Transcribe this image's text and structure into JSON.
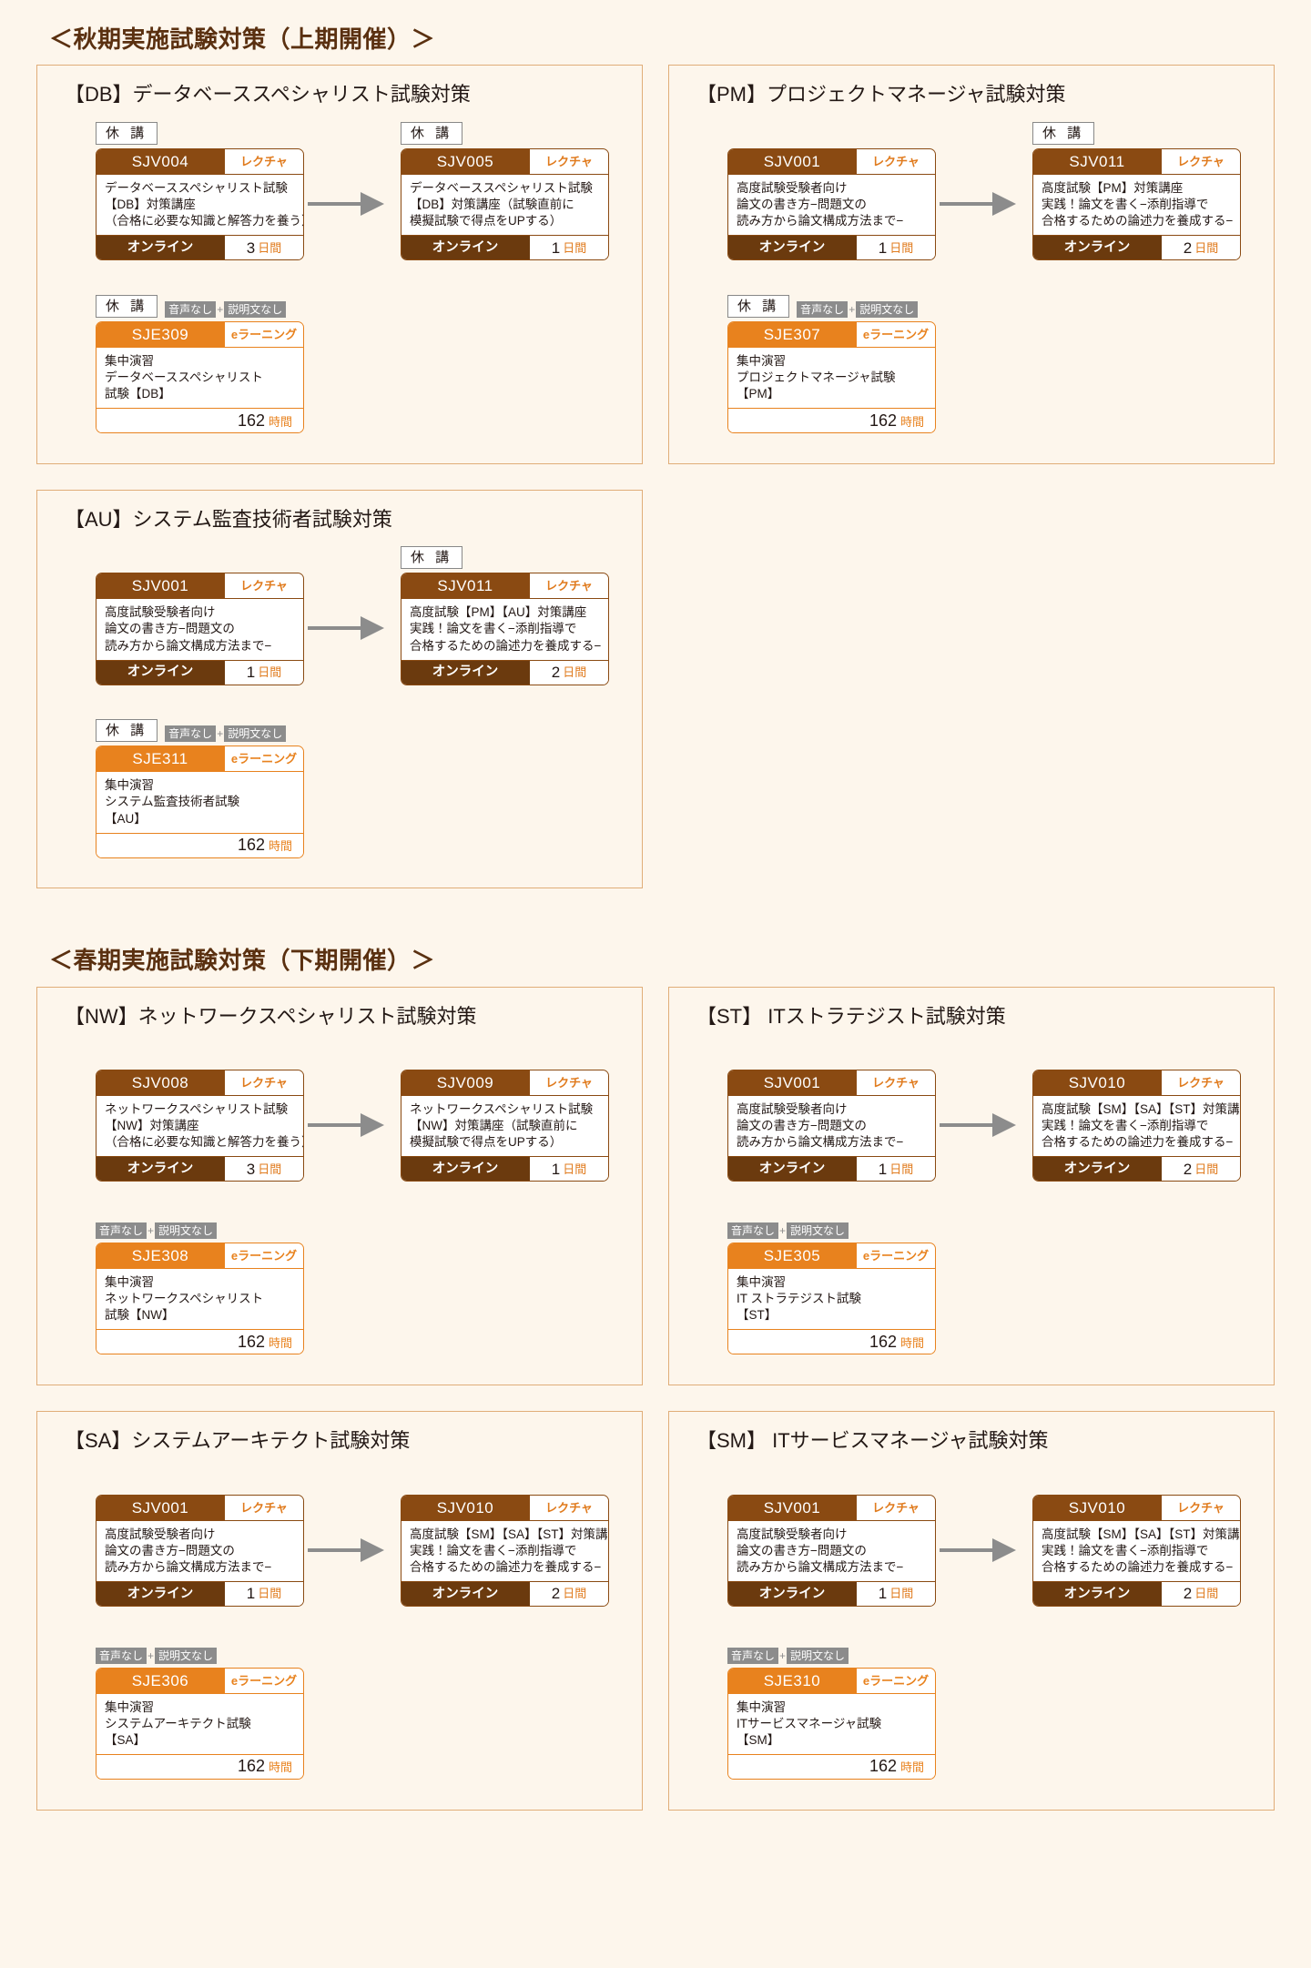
{
  "colors": {
    "background": "#fdf6ec",
    "panel_border": "#e0ad78",
    "lecture_brown": "#8a4a12",
    "lecture_foot_brown": "#6b3a0e",
    "elearning_orange": "#e8821e",
    "accent_orange": "#e07b1e",
    "heading_brown": "#5a3010",
    "arrow_gray": "#8c8c8c",
    "badge_gray": "#8c8c8c"
  },
  "labels": {
    "kyuko": "休 講",
    "no_audio": "音声なし",
    "no_caption": "説明文なし",
    "plus": "+",
    "kind_lecture": "レクチャ",
    "kind_elearning": "eラーニング",
    "mode_online": "オンライン",
    "unit_days": "日間",
    "unit_hours": "時間"
  },
  "seasons": [
    {
      "title": "＜秋期実施試験対策（上期開催）＞",
      "panel_rows": [
        {
          "panels": [
            {
              "id": "panel-db",
              "title": "【DB】データベーススペシャリスト試験対策",
              "flow": {
                "left": {
                  "badges": {
                    "kyuko": true,
                    "gray": false
                  },
                  "card": {
                    "type": "lecture",
                    "code": "SJV004",
                    "kind": "レクチャ",
                    "lines": [
                      "データベーススペシャリスト試験",
                      "【DB】対策講座",
                      "（合格に必要な知識と解答力を養う）"
                    ],
                    "mode": "オンライン",
                    "duration_value": "3",
                    "duration_unit": "日間"
                  }
                },
                "arrow": true,
                "right": {
                  "badges": {
                    "kyuko": true,
                    "gray": false
                  },
                  "card": {
                    "type": "lecture",
                    "code": "SJV005",
                    "kind": "レクチャ",
                    "lines": [
                      "データベーススペシャリスト試験",
                      "【DB】対策講座（試験直前に",
                      "模擬試験で得点をUPする）"
                    ],
                    "mode": "オンライン",
                    "duration_value": "1",
                    "duration_unit": "日間"
                  }
                }
              },
              "second": {
                "badges": {
                  "kyuko": true,
                  "gray": true
                },
                "card": {
                  "type": "elearn",
                  "code": "SJE309",
                  "kind": "eラーニング",
                  "lines": [
                    "集中演習",
                    "データベーススペシャリスト",
                    "試験【DB】"
                  ],
                  "hours_value": "162",
                  "hours_unit": "時間"
                }
              }
            },
            {
              "id": "panel-pm",
              "title": "【PM】プロジェクトマネージャ試験対策",
              "flow": {
                "left": {
                  "badges": {
                    "kyuko": false,
                    "gray": false
                  },
                  "card": {
                    "type": "lecture",
                    "code": "SJV001",
                    "kind": "レクチャ",
                    "lines": [
                      "高度試験受験者向け",
                      "論文の書き方−問題文の",
                      "読み方から論文構成方法まで−"
                    ],
                    "mode": "オンライン",
                    "duration_value": "1",
                    "duration_unit": "日間"
                  }
                },
                "arrow": true,
                "right": {
                  "badges": {
                    "kyuko": true,
                    "gray": false
                  },
                  "card": {
                    "type": "lecture",
                    "code": "SJV011",
                    "kind": "レクチャ",
                    "lines": [
                      "高度試験【PM】対策講座",
                      "実践！論文を書く−添削指導で",
                      "合格するための論述力を養成する−"
                    ],
                    "mode": "オンライン",
                    "duration_value": "2",
                    "duration_unit": "日間"
                  }
                }
              },
              "second": {
                "badges": {
                  "kyuko": true,
                  "gray": true
                },
                "card": {
                  "type": "elearn",
                  "code": "SJE307",
                  "kind": "eラーニング",
                  "lines": [
                    "集中演習",
                    "プロジェクトマネージャ試験",
                    "【PM】"
                  ],
                  "hours_value": "162",
                  "hours_unit": "時間"
                }
              }
            }
          ]
        },
        {
          "panels": [
            {
              "id": "panel-au",
              "title": "【AU】システム監査技術者試験対策",
              "flow": {
                "left": {
                  "badges": {
                    "kyuko": false,
                    "gray": false
                  },
                  "card": {
                    "type": "lecture",
                    "code": "SJV001",
                    "kind": "レクチャ",
                    "lines": [
                      "高度試験受験者向け",
                      "論文の書き方−問題文の",
                      "読み方から論文構成方法まで−"
                    ],
                    "mode": "オンライン",
                    "duration_value": "1",
                    "duration_unit": "日間"
                  }
                },
                "arrow": true,
                "right": {
                  "badges": {
                    "kyuko": true,
                    "gray": false
                  },
                  "card": {
                    "type": "lecture",
                    "code": "SJV011",
                    "kind": "レクチャ",
                    "lines": [
                      "高度試験【PM】【AU】対策講座",
                      "実践！論文を書く−添削指導で",
                      "合格するための論述力を養成する−"
                    ],
                    "mode": "オンライン",
                    "duration_value": "2",
                    "duration_unit": "日間"
                  }
                }
              },
              "second": {
                "badges": {
                  "kyuko": true,
                  "gray": true
                },
                "card": {
                  "type": "elearn",
                  "code": "SJE311",
                  "kind": "eラーニング",
                  "lines": [
                    "集中演習",
                    "システム監査技術者試験",
                    "【AU】"
                  ],
                  "hours_value": "162",
                  "hours_unit": "時間"
                }
              }
            }
          ]
        }
      ]
    },
    {
      "title": "＜春期実施試験対策（下期開催）＞",
      "panel_rows": [
        {
          "panels": [
            {
              "id": "panel-nw",
              "title": "【NW】ネットワークスペシャリスト試験対策",
              "flow": {
                "left": {
                  "badges": {
                    "kyuko": false,
                    "gray": false
                  },
                  "card": {
                    "type": "lecture",
                    "code": "SJV008",
                    "kind": "レクチャ",
                    "lines": [
                      "ネットワークスペシャリスト試験",
                      "【NW】対策講座",
                      "（合格に必要な知識と解答力を養う）"
                    ],
                    "mode": "オンライン",
                    "duration_value": "3",
                    "duration_unit": "日間"
                  }
                },
                "arrow": true,
                "right": {
                  "badges": {
                    "kyuko": false,
                    "gray": false
                  },
                  "card": {
                    "type": "lecture",
                    "code": "SJV009",
                    "kind": "レクチャ",
                    "lines": [
                      "ネットワークスペシャリスト試験",
                      "【NW】対策講座（試験直前に",
                      "模擬試験で得点をUPする）"
                    ],
                    "mode": "オンライン",
                    "duration_value": "1",
                    "duration_unit": "日間"
                  }
                }
              },
              "second": {
                "badges": {
                  "kyuko": false,
                  "gray": true
                },
                "card": {
                  "type": "elearn",
                  "code": "SJE308",
                  "kind": "eラーニング",
                  "lines": [
                    "集中演習",
                    "ネットワークスペシャリスト",
                    "試験【NW】"
                  ],
                  "hours_value": "162",
                  "hours_unit": "時間"
                }
              }
            },
            {
              "id": "panel-st",
              "title": "【ST】 ITストラテジスト試験対策",
              "flow": {
                "left": {
                  "badges": {
                    "kyuko": false,
                    "gray": false
                  },
                  "card": {
                    "type": "lecture",
                    "code": "SJV001",
                    "kind": "レクチャ",
                    "lines": [
                      "高度試験受験者向け",
                      "論文の書き方−問題文の",
                      "読み方から論文構成方法まで−"
                    ],
                    "mode": "オンライン",
                    "duration_value": "1",
                    "duration_unit": "日間"
                  }
                },
                "arrow": true,
                "right": {
                  "badges": {
                    "kyuko": false,
                    "gray": false
                  },
                  "card": {
                    "type": "lecture",
                    "code": "SJV010",
                    "kind": "レクチャ",
                    "lines": [
                      "高度試験【SM】【SA】【ST】対策講座",
                      "実践！論文を書く−添削指導で",
                      "合格するための論述力を養成する−"
                    ],
                    "mode": "オンライン",
                    "duration_value": "2",
                    "duration_unit": "日間"
                  }
                }
              },
              "second": {
                "badges": {
                  "kyuko": false,
                  "gray": true
                },
                "card": {
                  "type": "elearn",
                  "code": "SJE305",
                  "kind": "eラーニング",
                  "lines": [
                    "集中演習",
                    "IT ストラテジスト試験",
                    "【ST】"
                  ],
                  "hours_value": "162",
                  "hours_unit": "時間"
                }
              }
            }
          ]
        },
        {
          "panels": [
            {
              "id": "panel-sa",
              "title": "【SA】システムアーキテクト試験対策",
              "flow": {
                "left": {
                  "badges": {
                    "kyuko": false,
                    "gray": false
                  },
                  "card": {
                    "type": "lecture",
                    "code": "SJV001",
                    "kind": "レクチャ",
                    "lines": [
                      "高度試験受験者向け",
                      "論文の書き方−問題文の",
                      "読み方から論文構成方法まで−"
                    ],
                    "mode": "オンライン",
                    "duration_value": "1",
                    "duration_unit": "日間"
                  }
                },
                "arrow": true,
                "right": {
                  "badges": {
                    "kyuko": false,
                    "gray": false
                  },
                  "card": {
                    "type": "lecture",
                    "code": "SJV010",
                    "kind": "レクチャ",
                    "lines": [
                      "高度試験【SM】【SA】【ST】対策講座",
                      "実践！論文を書く−添削指導で",
                      "合格するための論述力を養成する−"
                    ],
                    "mode": "オンライン",
                    "duration_value": "2",
                    "duration_unit": "日間"
                  }
                }
              },
              "second": {
                "badges": {
                  "kyuko": false,
                  "gray": true
                },
                "card": {
                  "type": "elearn",
                  "code": "SJE306",
                  "kind": "eラーニング",
                  "lines": [
                    "集中演習",
                    "システムアーキテクト試験",
                    "【SA】"
                  ],
                  "hours_value": "162",
                  "hours_unit": "時間"
                }
              }
            },
            {
              "id": "panel-sm",
              "title": "【SM】 ITサービスマネージャ試験対策",
              "flow": {
                "left": {
                  "badges": {
                    "kyuko": false,
                    "gray": false
                  },
                  "card": {
                    "type": "lecture",
                    "code": "SJV001",
                    "kind": "レクチャ",
                    "lines": [
                      "高度試験受験者向け",
                      "論文の書き方−問題文の",
                      "読み方から論文構成方法まで−"
                    ],
                    "mode": "オンライン",
                    "duration_value": "1",
                    "duration_unit": "日間"
                  }
                },
                "arrow": true,
                "right": {
                  "badges": {
                    "kyuko": false,
                    "gray": false
                  },
                  "card": {
                    "type": "lecture",
                    "code": "SJV010",
                    "kind": "レクチャ",
                    "lines": [
                      "高度試験【SM】【SA】【ST】対策講座",
                      "実践！論文を書く−添削指導で",
                      "合格するための論述力を養成する−"
                    ],
                    "mode": "オンライン",
                    "duration_value": "2",
                    "duration_unit": "日間"
                  }
                }
              },
              "second": {
                "badges": {
                  "kyuko": false,
                  "gray": true
                },
                "card": {
                  "type": "elearn",
                  "code": "SJE310",
                  "kind": "eラーニング",
                  "lines": [
                    "集中演習",
                    "ITサービスマネージャ試験",
                    "【SM】"
                  ],
                  "hours_value": "162",
                  "hours_unit": "時間"
                }
              }
            }
          ]
        }
      ]
    }
  ]
}
